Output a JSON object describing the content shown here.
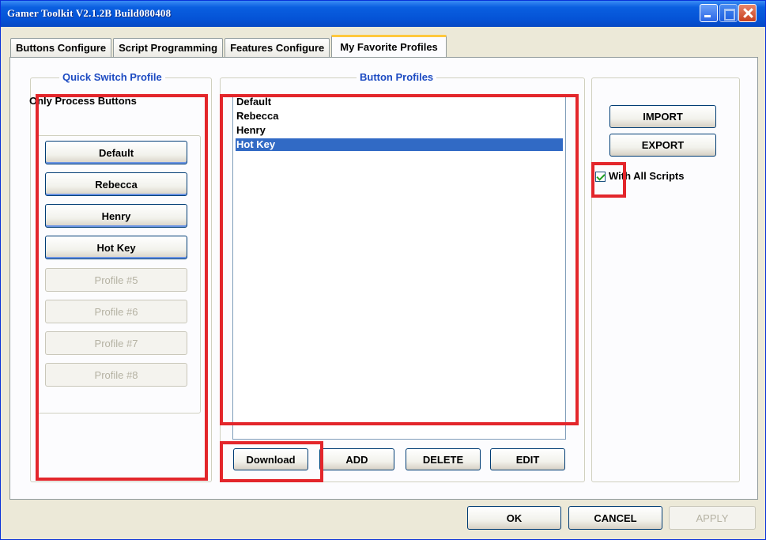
{
  "window": {
    "title": "Gamer Toolkit V2.1.2B Build080408"
  },
  "tabs": [
    {
      "label": "Buttons Configure"
    },
    {
      "label": "Script Programming"
    },
    {
      "label": "Features Configure"
    },
    {
      "label": "My Favorite Profiles",
      "active": true
    }
  ],
  "quick_switch": {
    "title": "Quick Switch Profile",
    "mode_label": "Only Process Buttons",
    "buttons": [
      {
        "label": "Default",
        "enabled": true
      },
      {
        "label": "Rebecca",
        "enabled": true
      },
      {
        "label": "Henry",
        "enabled": true
      },
      {
        "label": "Hot Key",
        "enabled": true
      },
      {
        "label": "Profile #5",
        "enabled": false
      },
      {
        "label": "Profile #6",
        "enabled": false
      },
      {
        "label": "Profile #7",
        "enabled": false
      },
      {
        "label": "Profile #8",
        "enabled": false
      }
    ]
  },
  "button_profiles": {
    "title": "Button Profiles",
    "items": [
      {
        "label": "Default",
        "selected": false
      },
      {
        "label": "Rebecca",
        "selected": false
      },
      {
        "label": "Henry",
        "selected": false
      },
      {
        "label": "Hot Key",
        "selected": true
      }
    ],
    "actions": {
      "download": "Download",
      "add": "ADD",
      "delete": "DELETE",
      "edit": "EDIT"
    }
  },
  "right_panel": {
    "import": "IMPORT",
    "export": "EXPORT",
    "with_all_scripts": "With All Scripts",
    "with_all_scripts_checked": true
  },
  "footer": {
    "ok": "OK",
    "cancel": "CANCEL",
    "apply": "APPLY",
    "apply_enabled": false
  },
  "colors": {
    "title_bar": "#0553d6",
    "group_title": "#1d4bc2",
    "selection": "#316ac5",
    "annotation_box": "#e3262b",
    "active_tab_accent": "#ffc83c"
  }
}
